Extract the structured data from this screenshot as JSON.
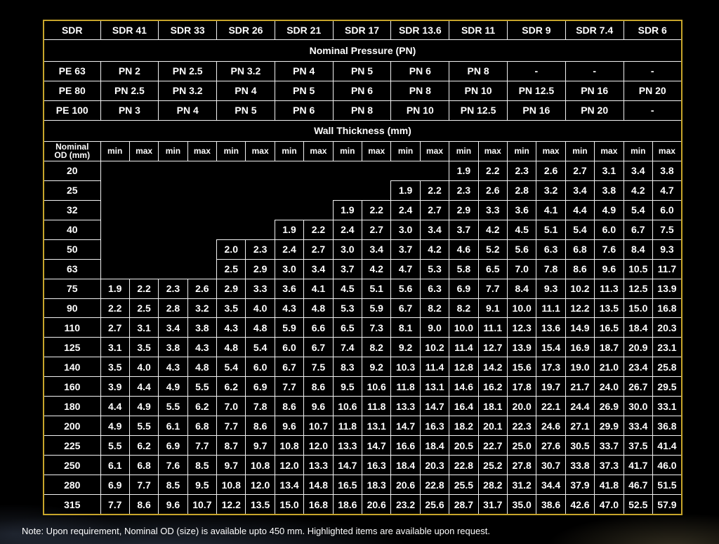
{
  "table": {
    "sdr_label": "SDR",
    "sdr_values": [
      "SDR 41",
      "SDR 33",
      "SDR 26",
      "SDR 21",
      "SDR 17",
      "SDR 13.6",
      "SDR 11",
      "SDR 9",
      "SDR 7.4",
      "SDR 6"
    ],
    "pressure_title": "Nominal Pressure (PN)",
    "pressure_rows": [
      {
        "material": "PE 63",
        "values": [
          "PN 2",
          "PN 2.5",
          "PN 3.2",
          "PN 4",
          "PN 5",
          "PN 6",
          "PN 8",
          "-",
          "-",
          "-"
        ]
      },
      {
        "material": "PE 80",
        "values": [
          "PN 2.5",
          "PN 3.2",
          "PN 4",
          "PN 5",
          "PN 6",
          "PN 8",
          "PN 10",
          "PN 12.5",
          "PN 16",
          "PN 20"
        ]
      },
      {
        "material": "PE 100",
        "values": [
          "PN 3",
          "PN 4",
          "PN 5",
          "PN 6",
          "PN 8",
          "PN 10",
          "PN 12.5",
          "PN 16",
          "PN 20",
          "-"
        ]
      }
    ],
    "wall_title": "Wall Thickness (mm)",
    "od_header_line1": "Nominal",
    "od_header_line2": "OD (mm)",
    "min_label": "min",
    "max_label": "max",
    "wall_rows": [
      {
        "od": "20",
        "values": [
          "",
          "",
          "",
          "",
          "",
          "",
          "",
          "",
          "",
          "",
          "",
          "",
          "1.9",
          "2.2",
          "2.3",
          "2.6",
          "2.7",
          "3.1",
          "3.4",
          "3.8"
        ]
      },
      {
        "od": "25",
        "values": [
          "",
          "",
          "",
          "",
          "",
          "",
          "",
          "",
          "",
          "",
          "1.9",
          "2.2",
          "2.3",
          "2.6",
          "2.8",
          "3.2",
          "3.4",
          "3.8",
          "4.2",
          "4.7"
        ]
      },
      {
        "od": "32",
        "values": [
          "",
          "",
          "",
          "",
          "",
          "",
          "",
          "",
          "1.9",
          "2.2",
          "2.4",
          "2.7",
          "2.9",
          "3.3",
          "3.6",
          "4.1",
          "4.4",
          "4.9",
          "5.4",
          "6.0"
        ]
      },
      {
        "od": "40",
        "values": [
          "",
          "",
          "",
          "",
          "",
          "",
          "1.9",
          "2.2",
          "2.4",
          "2.7",
          "3.0",
          "3.4",
          "3.7",
          "4.2",
          "4.5",
          "5.1",
          "5.4",
          "6.0",
          "6.7",
          "7.5"
        ]
      },
      {
        "od": "50",
        "values": [
          "",
          "",
          "",
          "",
          "2.0",
          "2.3",
          "2.4",
          "2.7",
          "3.0",
          "3.4",
          "3.7",
          "4.2",
          "4.6",
          "5.2",
          "5.6",
          "6.3",
          "6.8",
          "7.6",
          "8.4",
          "9.3"
        ]
      },
      {
        "od": "63",
        "values": [
          "",
          "",
          "",
          "",
          "2.5",
          "2.9",
          "3.0",
          "3.4",
          "3.7",
          "4.2",
          "4.7",
          "5.3",
          "5.8",
          "6.5",
          "7.0",
          "7.8",
          "8.6",
          "9.6",
          "10.5",
          "11.7"
        ]
      },
      {
        "od": "75",
        "values": [
          "1.9",
          "2.2",
          "2.3",
          "2.6",
          "2.9",
          "3.3",
          "3.6",
          "4.1",
          "4.5",
          "5.1",
          "5.6",
          "6.3",
          "6.9",
          "7.7",
          "8.4",
          "9.3",
          "10.2",
          "11.3",
          "12.5",
          "13.9"
        ]
      },
      {
        "od": "90",
        "values": [
          "2.2",
          "2.5",
          "2.8",
          "3.2",
          "3.5",
          "4.0",
          "4.3",
          "4.8",
          "5.3",
          "5.9",
          "6.7",
          "8.2",
          "8.2",
          "9.1",
          "10.0",
          "11.1",
          "12.2",
          "13.5",
          "15.0",
          "16.8"
        ]
      },
      {
        "od": "110",
        "values": [
          "2.7",
          "3.1",
          "3.4",
          "3.8",
          "4.3",
          "4.8",
          "5.9",
          "6.6",
          "6.5",
          "7.3",
          "8.1",
          "9.0",
          "10.0",
          "11.1",
          "12.3",
          "13.6",
          "14.9",
          "16.5",
          "18.4",
          "20.3"
        ]
      },
      {
        "od": "125",
        "values": [
          "3.1",
          "3.5",
          "3.8",
          "4.3",
          "4.8",
          "5.4",
          "6.0",
          "6.7",
          "7.4",
          "8.2",
          "9.2",
          "10.2",
          "11.4",
          "12.7",
          "13.9",
          "15.4",
          "16.9",
          "18.7",
          "20.9",
          "23.1"
        ]
      },
      {
        "od": "140",
        "values": [
          "3.5",
          "4.0",
          "4.3",
          "4.8",
          "5.4",
          "6.0",
          "6.7",
          "7.5",
          "8.3",
          "9.2",
          "10.3",
          "11.4",
          "12.8",
          "14.2",
          "15.6",
          "17.3",
          "19.0",
          "21.0",
          "23.4",
          "25.8"
        ]
      },
      {
        "od": "160",
        "values": [
          "3.9",
          "4.4",
          "4.9",
          "5.5",
          "6.2",
          "6.9",
          "7.7",
          "8.6",
          "9.5",
          "10.6",
          "11.8",
          "13.1",
          "14.6",
          "16.2",
          "17.8",
          "19.7",
          "21.7",
          "24.0",
          "26.7",
          "29.5"
        ]
      },
      {
        "od": "180",
        "values": [
          "4.4",
          "4.9",
          "5.5",
          "6.2",
          "7.0",
          "7.8",
          "8.6",
          "9.6",
          "10.6",
          "11.8",
          "13.3",
          "14.7",
          "16.4",
          "18.1",
          "20.0",
          "22.1",
          "24.4",
          "26.9",
          "30.0",
          "33.1"
        ]
      },
      {
        "od": "200",
        "values": [
          "4.9",
          "5.5",
          "6.1",
          "6.8",
          "7.7",
          "8.6",
          "9.6",
          "10.7",
          "11.8",
          "13.1",
          "14.7",
          "16.3",
          "18.2",
          "20.1",
          "22.3",
          "24.6",
          "27.1",
          "29.9",
          "33.4",
          "36.8"
        ]
      },
      {
        "od": "225",
        "values": [
          "5.5",
          "6.2",
          "6.9",
          "7.7",
          "8.7",
          "9.7",
          "10.8",
          "12.0",
          "13.3",
          "14.7",
          "16.6",
          "18.4",
          "20.5",
          "22.7",
          "25.0",
          "27.6",
          "30.5",
          "33.7",
          "37.5",
          "41.4"
        ]
      },
      {
        "od": "250",
        "values": [
          "6.1",
          "6.8",
          "7.6",
          "8.5",
          "9.7",
          "10.8",
          "12.0",
          "13.3",
          "14.7",
          "16.3",
          "18.4",
          "20.3",
          "22.8",
          "25.2",
          "27.8",
          "30.7",
          "33.8",
          "37.3",
          "41.7",
          "46.0"
        ]
      },
      {
        "od": "280",
        "values": [
          "6.9",
          "7.7",
          "8.5",
          "9.5",
          "10.8",
          "12.0",
          "13.4",
          "14.8",
          "16.5",
          "18.3",
          "20.6",
          "22.8",
          "25.5",
          "28.2",
          "31.2",
          "34.4",
          "37.9",
          "41.8",
          "46.7",
          "51.5"
        ]
      },
      {
        "od": "315",
        "values": [
          "7.7",
          "8.6",
          "9.6",
          "10.7",
          "12.2",
          "13.5",
          "15.0",
          "16.8",
          "18.6",
          "20.6",
          "23.2",
          "25.6",
          "28.7",
          "31.7",
          "35.0",
          "38.6",
          "42.6",
          "47.0",
          "52.5",
          "57.9"
        ]
      }
    ]
  },
  "note": "Note: Upon requirement, Nominal OD (size) is available upto 450 mm. Highlighted items are available upon request."
}
